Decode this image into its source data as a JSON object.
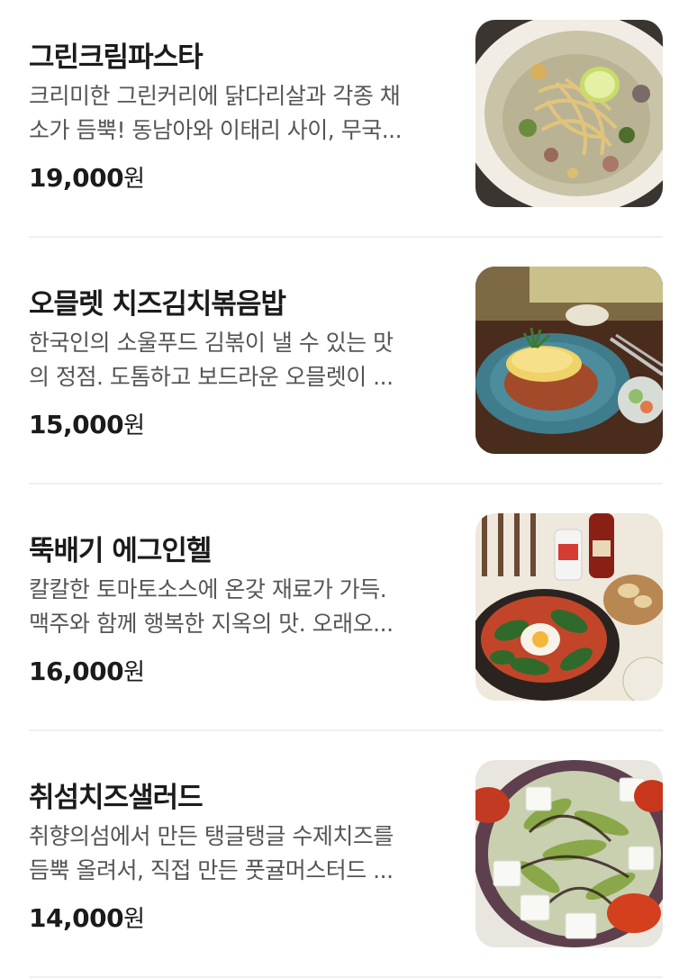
{
  "menu": [
    {
      "name": "그린크림파스타",
      "desc_line1": "크리미한 그린커리에 닭다리살과 각종 채",
      "desc_line2": "소가 듬뿍! 동남아와 이태리 사이, 무국...",
      "price": "19,000",
      "currency": "원",
      "photo": "green-cream-pasta-photo"
    },
    {
      "name": "오믈렛 치즈김치볶음밥",
      "desc_line1": "한국인의 소울푸드 김볶이 낼 수 있는 맛",
      "desc_line2": "의 정점. 도톰하고 보드라운 오믈렛이 ...",
      "price": "15,000",
      "currency": "원",
      "photo": "omelet-kimchi-fried-rice-photo"
    },
    {
      "name": "뚝배기 에그인헬",
      "desc_line1": "칼칼한 토마토소스에 온갖 재료가 가득.",
      "desc_line2": "맥주와 함께 행복한 지옥의 맛. 오래오...",
      "price": "16,000",
      "currency": "원",
      "photo": "ttukbaegi-egg-in-hell-photo"
    },
    {
      "name": "취섬치즈샐러드",
      "desc_line1": "취향의섬에서 만든 탱글탱글 수제치즈를",
      "desc_line2": "듬뿍 올려서, 직접 만든 풋귤머스터드 ...",
      "price": "14,000",
      "currency": "원",
      "photo": "chwiseom-cheese-salad-photo"
    }
  ]
}
